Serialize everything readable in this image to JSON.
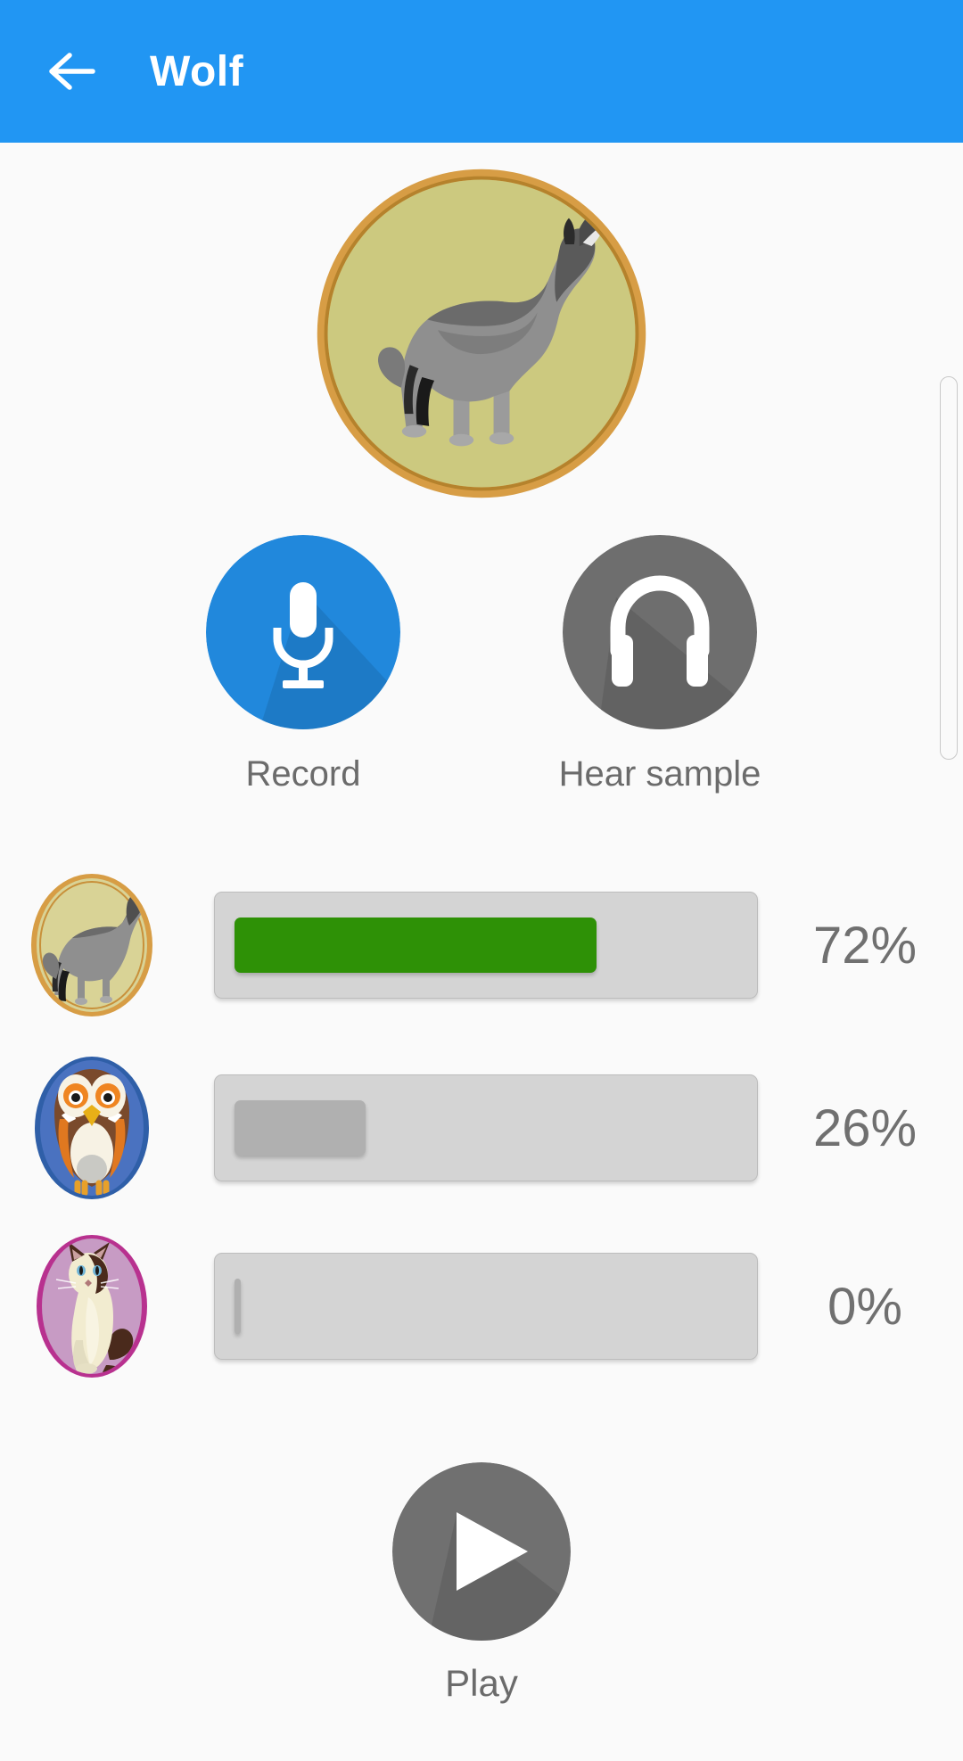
{
  "appbar": {
    "title": "Wolf",
    "back_icon": "arrow-back-icon",
    "background_color": "#2196f3",
    "title_color": "#ffffff"
  },
  "hero": {
    "name": "wolf-hero-image",
    "alt": "Howling wolf in circular olive frame",
    "frame_color": "#d79d45",
    "frame_inner_color": "#b5822c",
    "background_color": "#ccc97f"
  },
  "actions": [
    {
      "id": "record",
      "label": "Record",
      "icon": "microphone-icon",
      "circle_color": "#2188dc",
      "icon_color": "#ffffff"
    },
    {
      "id": "hear-sample",
      "label": "Hear sample",
      "icon": "headphones-icon",
      "circle_color": "#6e6e6e",
      "icon_color": "#ffffff"
    }
  ],
  "results": [
    {
      "id": "wolf",
      "animal": "wolf",
      "thumb_icon": "wolf-thumbnail",
      "percent": 72,
      "percent_label": "72%",
      "fill_color": "#2e9106",
      "frame_color": "#d79d45",
      "frame_bg": "#d9d396"
    },
    {
      "id": "owl",
      "animal": "owl",
      "thumb_icon": "owl-thumbnail",
      "percent": 26,
      "percent_label": "26%",
      "fill_color": "#b0b0b0",
      "frame_color": "#2f5fa8",
      "frame_bg": "#4a72c0"
    },
    {
      "id": "cat",
      "animal": "cat",
      "thumb_icon": "cat-thumbnail",
      "percent": 0,
      "percent_label": "0%",
      "fill_color": "#b0b0b0",
      "frame_color": "#b8318f",
      "frame_bg": "#c79bc4"
    }
  ],
  "play": {
    "label": "Play",
    "icon": "play-triangle-icon",
    "circle_color": "#707070",
    "icon_color": "#ffffff"
  },
  "scrollbar": {
    "name": "vertical-scrollbar"
  },
  "colors": {
    "page_background": "#fafafa",
    "bar_track": "#d4d4d4",
    "text_muted": "#6b6b6b"
  }
}
